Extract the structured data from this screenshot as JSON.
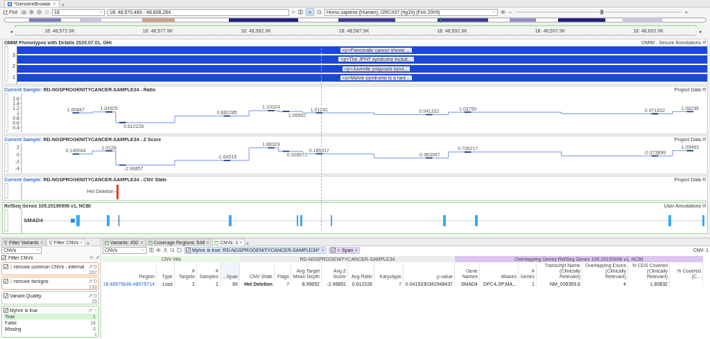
{
  "app_tabs": [
    {
      "label": "*GenomeBrowse",
      "selected": true
    }
  ],
  "toolbar": {
    "plot_label": "Plot",
    "chromosome": "18",
    "locus": "18: 48,570,489 - 48,608,284",
    "genome": "Homo sapiens (Human), GRCh37 (hg19) (Feb 2009)",
    "zoom": {
      "level": 0.52
    }
  },
  "ruler": {
    "ticks": [
      "18: 48,572.9K",
      "18: 48,577.9K",
      "18: 48,582.9K",
      "18: 48,587.9K",
      "18: 48,592.9K",
      "18: 48,597.9K",
      "18: 48,602.9K"
    ]
  },
  "tracks": [
    {
      "kind": "omim",
      "title": "OMIM Phenotypes with Details 2020.07.01, GHI",
      "source": "OMIM - Secure Annotations",
      "axis": [
        "3",
        "2",
        "1"
      ],
      "features": [
        "<p>Pancreatic cancer shows ...",
        "<p>The JPHT syndrome includ...",
        "<p>Juvenile polyposis synd...",
        "<p>Myhre syndrome is a rare..."
      ]
    },
    {
      "kind": "signal",
      "sample_label": "Current Sample:",
      "title": "RD-NGSPROGENITYCANCER-SAMPLE34 - Ratio",
      "source": "Project Data",
      "y_ticks": [
        "1.6",
        "1.4",
        "1.2",
        "1",
        "0.8",
        "0.6",
        "0.4"
      ],
      "value_labels": [
        "1.00847",
        "1.04925",
        "0.612226",
        "0.882285",
        "1.10024",
        "1.06592",
        "1.01241",
        "0.941332",
        "1.03759",
        "0.971832",
        "1.06245"
      ]
    },
    {
      "kind": "signal",
      "sample_label": "Current Sample:",
      "title": "RD-NGSPROGENITYCANCER-SAMPLE34 - Z Score",
      "source": "Project Data",
      "y_ticks": [
        "2",
        "0",
        "-2",
        "-4"
      ],
      "value_labels": [
        "0.149044",
        "1.0128",
        "-2.96857",
        "-1.64515",
        "1.88329",
        "0.928572",
        "0.185317",
        "-0.963947",
        "0.706217",
        "-0.373899",
        "1.09463"
      ]
    },
    {
      "kind": "state",
      "sample_label": "Current Sample:",
      "title": "RD-NGSPROGENITYCANCER-SAMPLE34 - CNV State",
      "source": "Project Data",
      "state_label": "Het Deletion"
    },
    {
      "kind": "genes",
      "title": "RefSeq Genes 105.20190906 v1, NCBI",
      "source": "User Annotations",
      "gene": "SMAD4"
    }
  ],
  "filter_panel": {
    "tabs": [
      {
        "label": "Filter Variants",
        "selected": false
      },
      {
        "label": "Filter CNVs",
        "selected": true
      }
    ],
    "dataset": "CNVs",
    "title": "Filter CNVs",
    "checked": true,
    "filters": [
      {
        "kind": "count",
        "prefix": "1",
        "label": "remove common CNVs - internal",
        "count": "167",
        "checked": true,
        "color": "#f2a777"
      },
      {
        "kind": "count",
        "prefix": "1",
        "label": "remove benigns",
        "count": "133",
        "checked": true,
        "color": "#f2a777"
      },
      {
        "kind": "count",
        "label": "Variant Quality",
        "count": "15",
        "checked": true,
        "color": "#c4c4c4"
      },
      {
        "kind": "values",
        "label": "Myhre is true",
        "checked": true,
        "color": "#8fd68f",
        "count": "1",
        "options": [
          {
            "label": "True",
            "count": "1",
            "selected": true
          },
          {
            "label": "False",
            "count": "14",
            "selected": false
          },
          {
            "label": "Missing",
            "count": "0",
            "selected": false
          }
        ]
      }
    ]
  },
  "table_panel": {
    "tabs": [
      {
        "label": "Variants: 452",
        "selected": false
      },
      {
        "label": "Coverage Regions: 548",
        "selected": false
      },
      {
        "label": "CNVs: 1",
        "selected": true
      }
    ],
    "dataset": "CNVs",
    "chips": [
      {
        "kind": "filter",
        "label": "Myhre is true: RD-NGSPROGENITYCANCER-SAMPLE34*",
        "checked": true
      },
      {
        "kind": "sort",
        "label": "Span",
        "checked": true
      }
    ],
    "count": "CNV: 1",
    "groups": [
      {
        "label": "CNV Info",
        "color": "#e9f6e5",
        "columns": [
          {
            "label": "Region",
            "kind": "link",
            "sorted": false
          },
          {
            "label": "Type",
            "kind": "text",
            "sorted": false
          },
          {
            "label": "# Targets",
            "kind": "text",
            "sorted": false
          },
          {
            "label": "# Samples",
            "kind": "text",
            "sorted": false
          },
          {
            "label": "Span",
            "kind": "text",
            "sorted": true
          }
        ]
      },
      {
        "label": "RD-NGSPROGENITYCANCER-SAMPLE34",
        "color": "#ececec",
        "columns": [
          {
            "label": "CNV State",
            "kind": "bold",
            "sorted": false
          },
          {
            "label": "Flags",
            "kind": "text",
            "sorted": false
          },
          {
            "label": "Avg Target Mean Depth",
            "kind": "text",
            "sorted": false
          },
          {
            "label": "Avg Z Score",
            "kind": "text",
            "sorted": false
          },
          {
            "label": "Avg Ratio",
            "kind": "text",
            "sorted": false
          },
          {
            "label": "Karyotype",
            "kind": "text",
            "sorted": false
          },
          {
            "label": "p-value",
            "kind": "text",
            "sorted": false
          }
        ]
      },
      {
        "label": "Overlapping Genes RefSeq Genes 105.20190906 v1, NCBI",
        "color": "#dcc5f0",
        "columns": [
          {
            "label": "Gene Names",
            "kind": "text",
            "sorted": false
          },
          {
            "label": "Aliases",
            "kind": "text",
            "sorted": false
          },
          {
            "label": "# Genes",
            "kind": "text",
            "sorted": false
          },
          {
            "label": "Transcript Name (Clinically Relevant)",
            "kind": "text",
            "sorted": false
          },
          {
            "label": "Overlapping Exons (Clinically Relevant)",
            "kind": "text",
            "sorted": false
          },
          {
            "label": "% CDS Covered (Clinically Relevant)",
            "kind": "text",
            "sorted": false
          },
          {
            "label": "% Covered (C...",
            "kind": "text",
            "sorted": false
          }
        ]
      }
    ],
    "rows": [
      {
        "cells": [
          "18:48575646-48575714",
          "Loss",
          "1",
          "1",
          "69",
          "Het Deletion",
          "?",
          "8.95652",
          "-2.96851",
          "0.612226",
          "?",
          "0.0415330342948437",
          "SMAD4",
          "DPC4,JIP,MA...",
          "1",
          "NM_005359.6",
          "4",
          "1.80832"
        ]
      }
    ]
  }
}
